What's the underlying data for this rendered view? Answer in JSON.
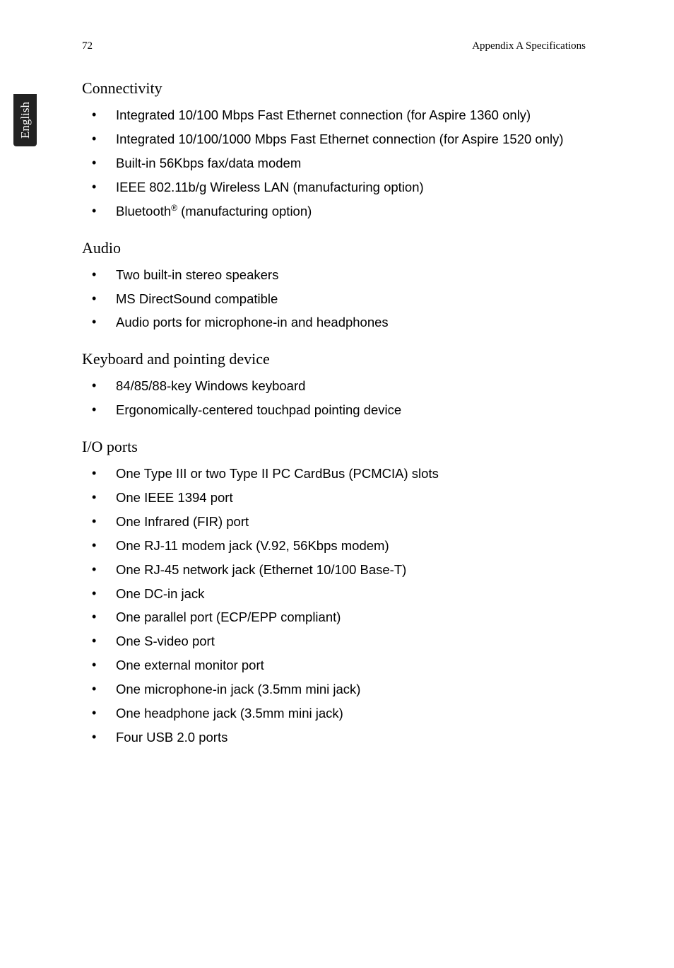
{
  "header": {
    "page_number": "72",
    "section": "Appendix A Specifications"
  },
  "sidebar": {
    "language": "English"
  },
  "sections": [
    {
      "heading": "Connectivity",
      "items": [
        "Integrated 10/100 Mbps Fast Ethernet connection (for Aspire 1360 only)",
        "Integrated 10/100/1000 Mbps Fast Ethernet connection (for Aspire 1520 only)",
        "Built-in 56Kbps fax/data modem",
        "IEEE 802.11b/g Wireless LAN (manufacturing option)",
        "Bluetooth® (manufacturing option)"
      ]
    },
    {
      "heading": "Audio",
      "items": [
        "Two built-in stereo speakers",
        "MS DirectSound compatible",
        "Audio ports for microphone-in and headphones"
      ]
    },
    {
      "heading": "Keyboard and pointing device",
      "items": [
        "84/85/88-key Windows keyboard",
        "Ergonomically-centered touchpad pointing device"
      ]
    },
    {
      "heading": "I/O ports",
      "items": [
        "One Type III or two Type II PC CardBus (PCMCIA) slots",
        "One IEEE 1394 port",
        "One Infrared (FIR) port",
        "One RJ-11 modem jack (V.92, 56Kbps modem)",
        "One RJ-45 network jack (Ethernet 10/100 Base-T)",
        "One DC-in jack",
        "One parallel port (ECP/EPP compliant)",
        "One S-video port",
        "One external monitor port",
        "One microphone-in jack (3.5mm mini jack)",
        "One headphone jack (3.5mm mini jack)",
        "Four USB 2.0 ports"
      ]
    }
  ]
}
